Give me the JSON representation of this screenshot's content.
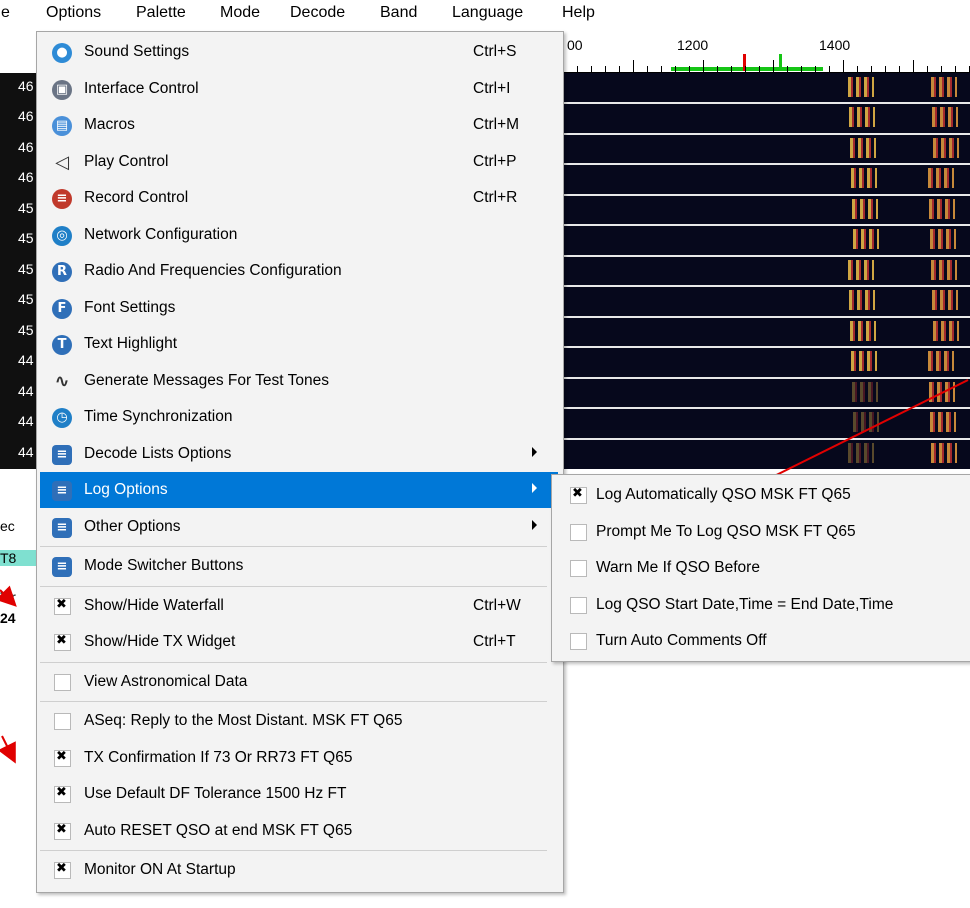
{
  "menubar": {
    "items": [
      "e",
      "Options",
      "Palette",
      "Mode",
      "Decode",
      "Band",
      "Language",
      "Help"
    ]
  },
  "ruler": {
    "labels": [
      "00",
      "1200",
      "1400"
    ]
  },
  "left_strip": {
    "numbers": [
      "46",
      "46",
      "46",
      "46",
      "45",
      "45",
      "45",
      "45",
      "45",
      "44",
      "44",
      "44",
      "44"
    ],
    "labels": [
      "ec",
      "T8",
      "Tir",
      "24"
    ]
  },
  "options_menu": {
    "items": [
      {
        "label": "Sound Settings",
        "shortcut": "Ctrl+S",
        "icon": "sound-settings-icon",
        "color": "#2e8bd6"
      },
      {
        "label": "Interface Control",
        "shortcut": "Ctrl+I",
        "icon": "interface-control-icon",
        "color": "#6a7485"
      },
      {
        "label": "Macros",
        "shortcut": "Ctrl+M",
        "icon": "macros-icon",
        "color": "#4a90d9"
      },
      {
        "label": "Play Control",
        "shortcut": "Ctrl+P",
        "icon": "speaker-icon",
        "color": "#7a7a7a"
      },
      {
        "label": "Record Control",
        "shortcut": "Ctrl+R",
        "icon": "record-control-icon",
        "color": "#c0392b"
      },
      {
        "label": "Network Configuration",
        "shortcut": "",
        "icon": "globe-icon",
        "color": "#1f7fc7"
      },
      {
        "label": "Radio And Frequencies Configuration",
        "shortcut": "",
        "icon": "letter-r-icon",
        "color": "#2f6fb8"
      },
      {
        "label": "Font Settings",
        "shortcut": "",
        "icon": "letter-f-icon",
        "color": "#2f6fb8"
      },
      {
        "label": "Text Highlight",
        "shortcut": "",
        "icon": "letter-t-icon",
        "color": "#2f6fb8"
      },
      {
        "label": "Generate Messages For Test Tones",
        "shortcut": "",
        "icon": "sine-wave-icon",
        "color": "#333333"
      },
      {
        "label": "Time Synchronization",
        "shortcut": "",
        "icon": "clock-sync-icon",
        "color": "#1f7fc7"
      },
      {
        "label": "Decode Lists Options",
        "shortcut": "",
        "icon": "list-icon",
        "color": "#2f6fb8",
        "submenu": true
      },
      {
        "label": "Log Options",
        "shortcut": "",
        "icon": "list-icon",
        "color": "#2f6fb8",
        "submenu": true,
        "highlighted": true
      },
      {
        "label": "Other Options",
        "shortcut": "",
        "icon": "list-icon",
        "color": "#2f6fb8",
        "submenu": true
      },
      {
        "label": "Mode Switcher Buttons",
        "shortcut": "",
        "icon": "list-icon",
        "color": "#2f6fb8"
      },
      {
        "label": "Show/Hide Waterfall",
        "shortcut": "Ctrl+W",
        "checked": true
      },
      {
        "label": "Show/Hide TX Widget",
        "shortcut": "Ctrl+T",
        "checked": true
      },
      {
        "label": "View Astronomical Data",
        "shortcut": "",
        "checked": false
      },
      {
        "label": "ASeq: Reply to the Most Distant. MSK FT Q65",
        "shortcut": "",
        "checked": false
      },
      {
        "label": "TX Confirmation If 73 Or RR73 FT Q65",
        "shortcut": "",
        "checked": true
      },
      {
        "label": "Use Default DF Tolerance 1500 Hz FT",
        "shortcut": "",
        "checked": true
      },
      {
        "label": "Auto RESET QSO at end MSK FT Q65",
        "shortcut": "",
        "checked": true
      },
      {
        "label": "Monitor ON At Startup",
        "shortcut": "",
        "checked": true
      }
    ]
  },
  "log_submenu": {
    "items": [
      {
        "label": "Log Automatically QSO MSK FT Q65",
        "checked": true
      },
      {
        "label": "Prompt Me To Log QSO MSK FT Q65",
        "checked": false
      },
      {
        "label": "Warn Me If QSO Before",
        "checked": false
      },
      {
        "label": "Log QSO Start Date,Time = End Date,Time",
        "checked": false
      },
      {
        "label": "Turn Auto Comments Off",
        "checked": false
      }
    ]
  },
  "colors": {
    "highlight": "#0078d7",
    "arrow": "#e00000",
    "waterfall": "#06081c"
  }
}
